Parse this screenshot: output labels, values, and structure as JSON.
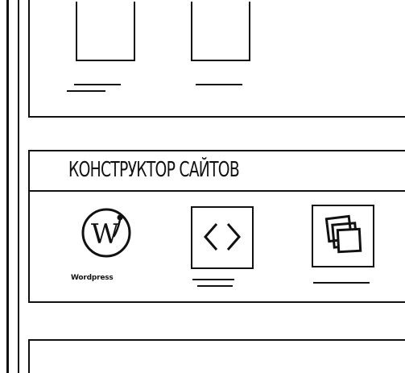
{
  "sections": [
    {
      "title": "",
      "items": [
        {
          "icon": "blank-thumbnail-icon"
        },
        {
          "icon": "blank-thumbnail-icon"
        }
      ]
    },
    {
      "title": "КОНСТРУКТОР САЙТОВ",
      "items": [
        {
          "icon": "wordpress-logo-icon",
          "caption": "Wordpress"
        },
        {
          "icon": "code-brackets-icon",
          "caption": ""
        },
        {
          "icon": "layers-icon",
          "caption": ""
        }
      ]
    },
    {
      "title": "",
      "items": []
    }
  ],
  "colors": {
    "ink": "#111111",
    "paper": "#ffffff"
  }
}
